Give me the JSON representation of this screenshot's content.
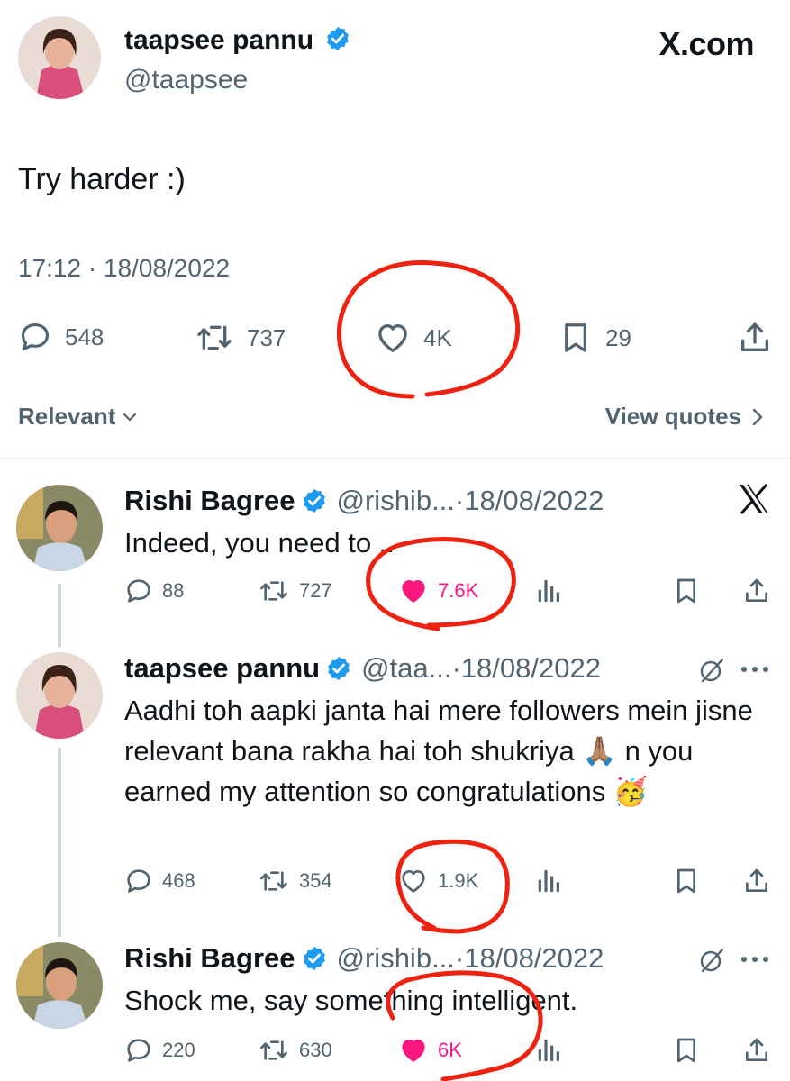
{
  "main_tweet": {
    "name": "taapsee pannu",
    "handle": "@taapsee",
    "source_logo": "X.com",
    "text": "Try harder :)",
    "timestamp": "17:12 · 18/08/2022",
    "stats": {
      "replies": "548",
      "reposts": "737",
      "likes": "4K",
      "bookmarks": "29"
    }
  },
  "sort": {
    "label": "Relevant",
    "view_quotes": "View quotes"
  },
  "replies": [
    {
      "name": "Rishi Bagree",
      "handle": "@rishib...",
      "date": "·18/08/2022",
      "text": "Indeed, you need to ..",
      "stats": {
        "replies": "88",
        "reposts": "727",
        "likes": "7.6K"
      },
      "liked": true
    },
    {
      "name": "taapsee pannu",
      "handle": "@taa...",
      "date": "·18/08/2022",
      "text": "Aadhi toh aapki janta hai mere followers mein jisne relevant bana rakha hai toh shukriya 🙏🏽 n you earned my attention so congratulations 🥳",
      "stats": {
        "replies": "468",
        "reposts": "354",
        "likes": "1.9K"
      },
      "liked": false
    },
    {
      "name": "Rishi Bagree",
      "handle": "@rishib...",
      "date": "·18/08/2022",
      "text": "Shock me, say something intelligent.",
      "stats": {
        "replies": "220",
        "reposts": "630",
        "likes": "6K"
      },
      "liked": true
    }
  ],
  "colors": {
    "verified": "#1d9bf0",
    "like": "#f91880",
    "muted": "#536471",
    "annotation": "#ee2211"
  }
}
